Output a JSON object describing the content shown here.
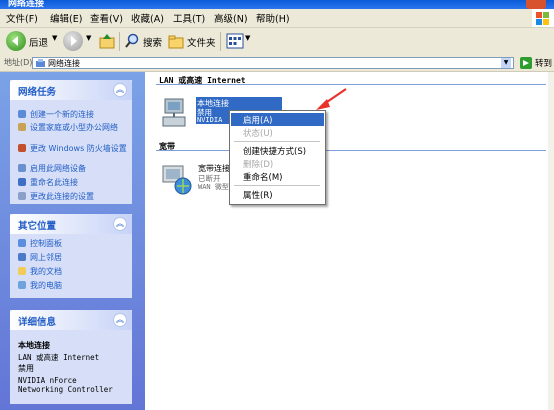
{
  "window": {
    "title": "网络连接"
  },
  "menubar": {
    "items": [
      "文件(F)",
      "编辑(E)",
      "查看(V)",
      "收藏(A)",
      "工具(T)",
      "高级(N)",
      "帮助(H)"
    ]
  },
  "toolbar": {
    "back_label": "后退",
    "search_label": "搜索",
    "folders_label": "文件夹"
  },
  "address": {
    "label": "地址(D)",
    "value": "网络连接",
    "go_label": "转到"
  },
  "sidebar": {
    "network_tasks": {
      "title": "网络任务",
      "items": [
        "创建一个新的连接",
        "设置家庭或小型办公网络",
        "更改 Windows 防火墙设置",
        "启用此网络设备",
        "重命名此连接",
        "更改此连接的设置"
      ]
    },
    "other_places": {
      "title": "其它位置",
      "items": [
        "控制面板",
        "网上邻居",
        "我的文档",
        "我的电脑"
      ]
    },
    "details": {
      "title": "详细信息",
      "name": "本地连接",
      "type": "LAN 或高速 Internet",
      "status": "禁用",
      "device": "NVIDIA nForce Networking Controller"
    }
  },
  "main": {
    "group_lan": "LAN 或高速 Internet",
    "group_broadband": "宽带",
    "local_connection": {
      "name": "本地连接",
      "status": "禁用",
      "device": "NVIDIA"
    },
    "broadband_connection": {
      "name": "宽带连接",
      "status": "已断开",
      "device": "WAN 微型"
    }
  },
  "context_menu": {
    "items": [
      {
        "label": "启用(A)",
        "state": "selected"
      },
      {
        "label": "状态(U)",
        "state": "disabled"
      },
      {
        "label": "创建快捷方式(S)",
        "state": "normal"
      },
      {
        "label": "删除(D)",
        "state": "disabled"
      },
      {
        "label": "重命名(M)",
        "state": "normal"
      },
      {
        "label": "属性(R)",
        "state": "normal"
      }
    ]
  },
  "colors": {
    "accent": "#316ac5",
    "arrow": "#e8322a",
    "task_link": "#215dc6"
  }
}
